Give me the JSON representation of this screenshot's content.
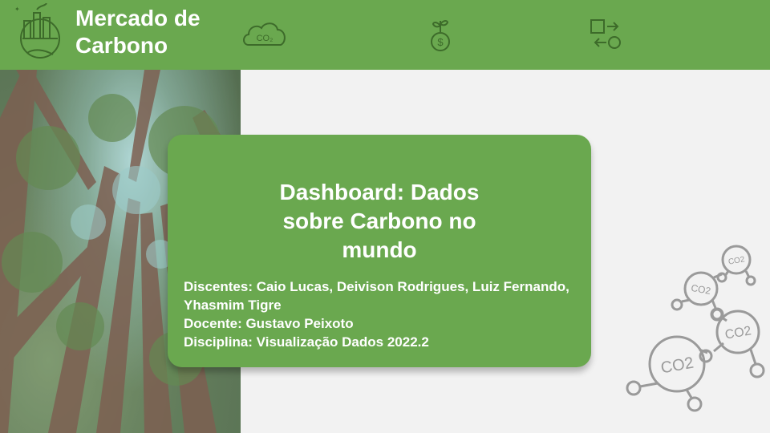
{
  "header": {
    "title_line1": "Mercado de",
    "title_line2": "Carbono",
    "icons": [
      "earth-factory-icon",
      "co2-cloud-icon",
      "money-plant-icon",
      "exchange-icon"
    ],
    "cloud_text": "CO₂"
  },
  "card": {
    "title": "Dashboard: Dados sobre Carbono no mundo",
    "discentes": "Discentes: Caio Lucas, Deivison Rodrigues, Luiz Fernando, Yhasmim Tigre",
    "docente": "Docente: Gustavo Peixoto",
    "disciplina": "Disciplina: Visualização Dados 2022.2"
  },
  "decoration": {
    "molecule_label": "CO2"
  },
  "colors": {
    "accent": "#6aa84f",
    "background": "#f2f2f2"
  }
}
